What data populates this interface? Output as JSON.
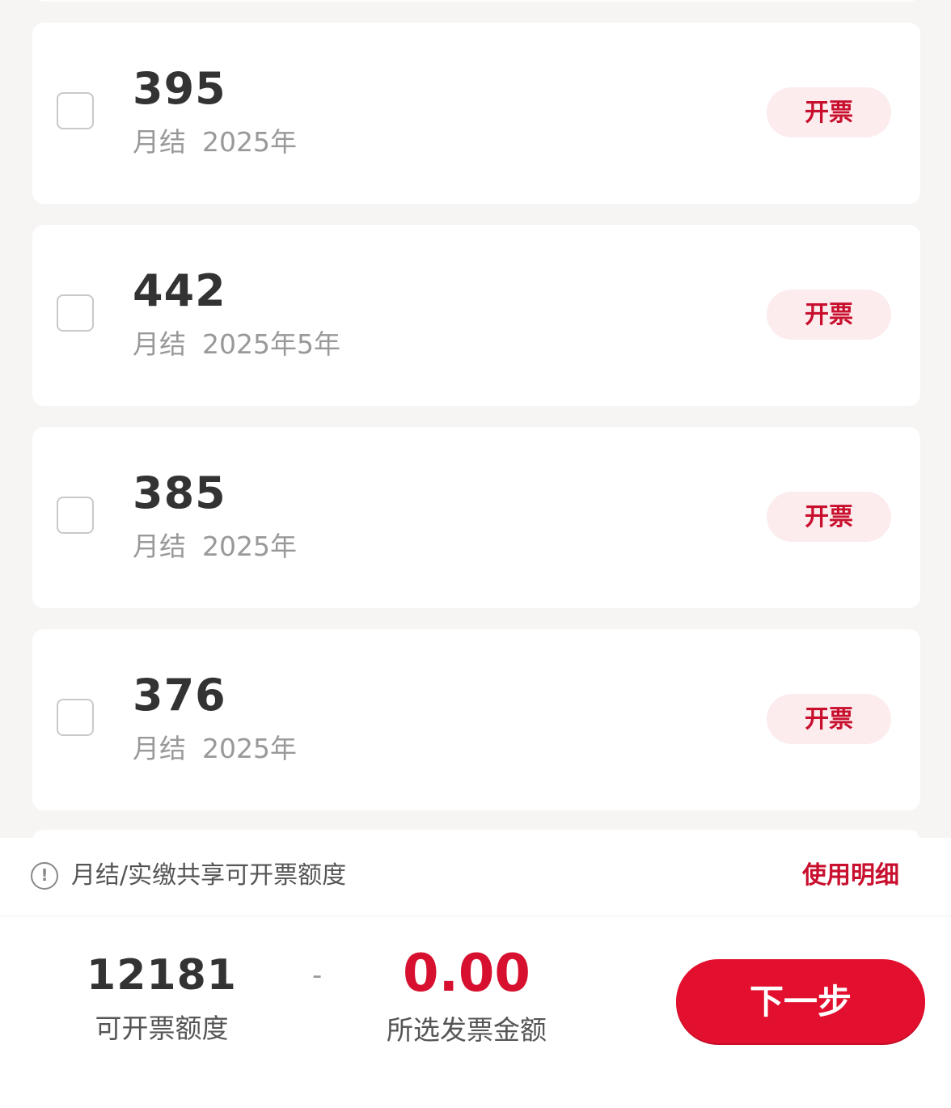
{
  "cards": [
    {
      "amount": "395",
      "type": "月结",
      "date": "2025年",
      "action": "开票"
    },
    {
      "amount": "442",
      "type": "月结",
      "date": "2025年5年",
      "action": "开票"
    },
    {
      "amount": "385",
      "type": "月结",
      "date": "2025年",
      "action": "开票"
    },
    {
      "amount": "376",
      "type": "月结",
      "date": "2025年",
      "action": "开票"
    }
  ],
  "notice": {
    "text": "月结/实缴共享可开票额度",
    "link": "使用明细"
  },
  "summary": {
    "quota_value": "12181",
    "quota_label": "可开票额度",
    "separator": "-",
    "selected_value": "0.00",
    "selected_label": "所选发票金额",
    "next_label": "下一步"
  },
  "colors": {
    "accent": "#e30f2e",
    "accent_text": "#c8102e",
    "button_tint": "#fcecee",
    "background": "#f7f4f4"
  }
}
